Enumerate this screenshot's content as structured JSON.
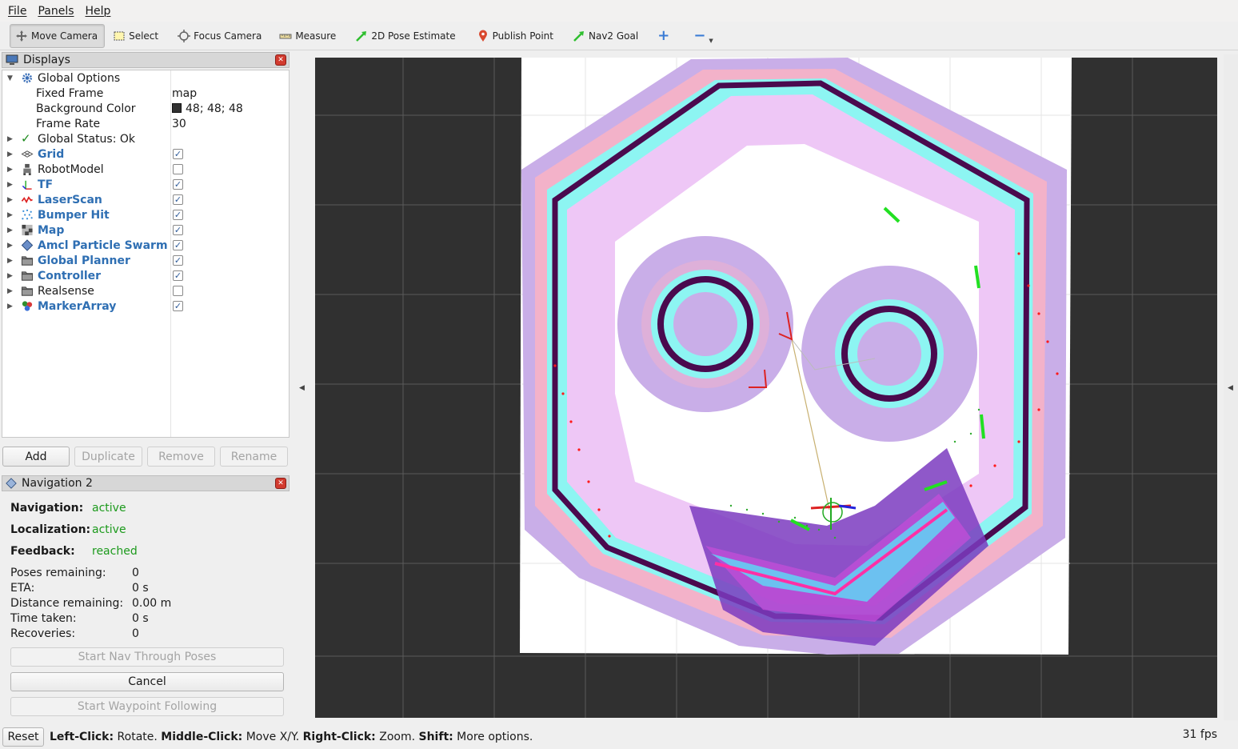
{
  "menu": {
    "file": "File",
    "panels": "Panels",
    "help": "Help"
  },
  "toolbar": {
    "move_camera": "Move Camera",
    "select": "Select",
    "focus_camera": "Focus Camera",
    "measure": "Measure",
    "pose_estimate": "2D Pose Estimate",
    "publish_point": "Publish Point",
    "nav2_goal": "Nav2 Goal",
    "plus": "+",
    "minus": "−"
  },
  "displays": {
    "title": "Displays",
    "global_options": "Global Options",
    "fixed_frame_label": "Fixed Frame",
    "fixed_frame_value": "map",
    "background_color_label": "Background Color",
    "background_color_value": "48; 48; 48",
    "frame_rate_label": "Frame Rate",
    "frame_rate_value": "30",
    "global_status": "Global Status: Ok",
    "items": [
      {
        "label": "Grid",
        "checked": true
      },
      {
        "label": "RobotModel",
        "checked": false
      },
      {
        "label": "TF",
        "checked": true
      },
      {
        "label": "LaserScan",
        "checked": true
      },
      {
        "label": "Bumper Hit",
        "checked": true
      },
      {
        "label": "Map",
        "checked": true
      },
      {
        "label": "Amcl Particle Swarm",
        "checked": true
      },
      {
        "label": "Global Planner",
        "checked": true
      },
      {
        "label": "Controller",
        "checked": true
      },
      {
        "label": "Realsense",
        "checked": false
      },
      {
        "label": "MarkerArray",
        "checked": true
      }
    ],
    "add": "Add",
    "duplicate": "Duplicate",
    "remove": "Remove",
    "rename": "Rename"
  },
  "navigation": {
    "title": "Navigation 2",
    "navigation_label": "Navigation:",
    "navigation_value": "active",
    "localization_label": "Localization:",
    "localization_value": "active",
    "feedback_label": "Feedback:",
    "feedback_value": "reached",
    "poses_remaining_label": "Poses remaining:",
    "poses_remaining_value": "0",
    "eta_label": "ETA:",
    "eta_value": "0 s",
    "distance_label": "Distance remaining:",
    "distance_value": "0.00 m",
    "time_label": "Time taken:",
    "time_value": "0 s",
    "recoveries_label": "Recoveries:",
    "recoveries_value": "0",
    "start_nav_poses": "Start Nav Through Poses",
    "cancel": "Cancel",
    "start_waypoint": "Start Waypoint Following"
  },
  "status": {
    "reset": "Reset",
    "left_click": "Left-Click:",
    "rotate": " Rotate. ",
    "middle_click": "Middle-Click:",
    "move_xy": " Move X/Y. ",
    "right_click": "Right-Click:",
    "zoom": " Zoom. ",
    "shift": "Shift:",
    "more": " More options.",
    "fps": "31 fps"
  },
  "colors": {
    "background": "#303030",
    "wall": "#4a0a4e",
    "inflation_cyan": "#7ff5f5",
    "inflation_purple": "#c8a8e8",
    "path": "#ff0090",
    "active": "#1c9a1c",
    "link": "#2f6fb3"
  }
}
